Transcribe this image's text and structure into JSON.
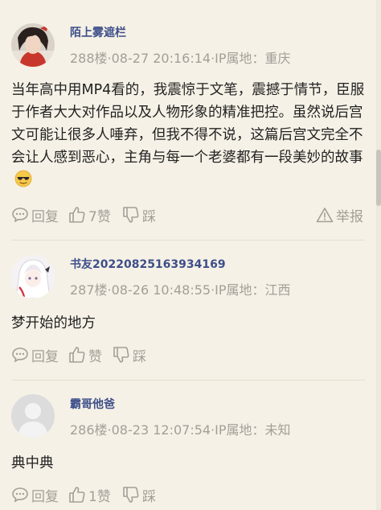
{
  "comments": [
    {
      "username": "陌上雾遮栏",
      "meta": "288楼·08-27 20:16:14·IP属地：重庆",
      "body": "当年高中用MP4看的，我震惊于文笔，震撼于情节，臣服于作者大大对作品以及人物形象的精准把控。虽然说后宫文可能让很多人唾弃，但我不得不说，这篇后宫文完全不会让人感到恶心，主角与每一个老婆都有一段美妙的故事",
      "reply_label": "回复",
      "like_label": "7赞",
      "dislike_label": "踩",
      "report_label": "举报",
      "emoji": "sunglasses-emoji"
    },
    {
      "username": "书友20220825163934169",
      "meta": "287楼·08-26 10:48:55·IP属地：江西",
      "body": "梦开始的地方",
      "reply_label": "回复",
      "like_label": "赞",
      "dislike_label": "踩"
    },
    {
      "username": "霸哥他爸",
      "meta": "286楼·08-23 12:07:54·IP属地：未知",
      "body": "典中典",
      "reply_label": "回复",
      "like_label": "1赞",
      "dislike_label": "踩"
    }
  ],
  "colors": {
    "background": "#f6f1e6",
    "username": "#3d4f8a",
    "meta": "#a39f98",
    "body": "#222222"
  }
}
